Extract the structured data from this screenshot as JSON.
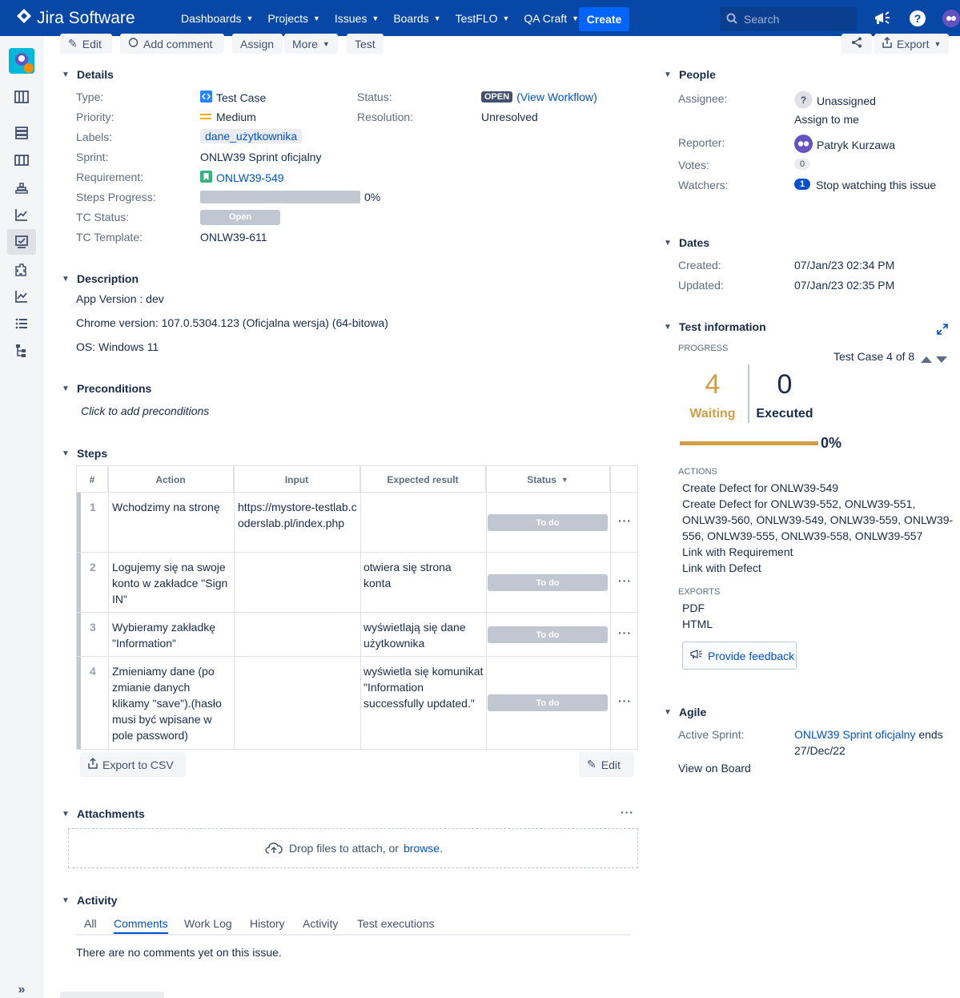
{
  "topnav": {
    "product": "Jira Software",
    "menu": [
      "Dashboards",
      "Projects",
      "Issues",
      "Boards",
      "TestFLO",
      "QA Craft"
    ],
    "create_label": "Create",
    "search_placeholder": "Search",
    "colors": {
      "nav_bg": "#0747a6",
      "create_bg": "#0065ff"
    }
  },
  "sidebar": {
    "items": [
      "project-avatar",
      "board-icon",
      "backlog-icon",
      "board-columns-icon",
      "releases-icon",
      "reports-icon",
      "test-plan-icon",
      "addons-icon",
      "chart-icon",
      "list-icon",
      "tree-icon",
      "expand-icon"
    ]
  },
  "toolbar": {
    "edit": "Edit",
    "add_comment": "Add comment",
    "assign": "Assign",
    "more": "More",
    "test": "Test",
    "export": "Export"
  },
  "details": {
    "title": "Details",
    "type_label": "Type:",
    "type_value": "Test Case",
    "priority_label": "Priority:",
    "priority_value": "Medium",
    "labels_label": "Labels:",
    "labels_value": "dane_użytkownika",
    "sprint_label": "Sprint:",
    "sprint_value": "ONLW39 Sprint oficjalny",
    "requirement_label": "Requirement:",
    "requirement_value": "ONLW39-549",
    "steps_progress_label": "Steps Progress:",
    "steps_progress_value": "0%",
    "steps_progress_fraction": 0,
    "tc_status_label": "TC Status:",
    "tc_status_value": "Open",
    "tc_template_label": "TC Template:",
    "tc_template_value": "ONLW39-611",
    "status_label": "Status:",
    "status_value": "OPEN",
    "view_workflow": "(View Workflow)",
    "resolution_label": "Resolution:",
    "resolution_value": "Unresolved"
  },
  "description": {
    "title": "Description",
    "lines": [
      "App Version : dev",
      "Chrome version: 107.0.5304.123 (Oficjalna wersja) (64-bitowa)",
      "OS: Windows 11"
    ]
  },
  "preconditions": {
    "title": "Preconditions",
    "placeholder": "Click to add preconditions"
  },
  "steps": {
    "title": "Steps",
    "columns": [
      "#",
      "Action",
      "Input",
      "Expected result",
      "Status"
    ],
    "rows": [
      {
        "num": "1",
        "action": "Wchodzimy na stronę",
        "input": "https://mystore-testlab.coderslab.pl/index.php",
        "expected": "",
        "status": "To do"
      },
      {
        "num": "2",
        "action": "Logujemy się na swoje konto w zakładce \"Sign IN\"",
        "input": "",
        "expected": "otwiera się strona konta",
        "status": "To do"
      },
      {
        "num": "3",
        "action": "Wybieramy zakładkę \"Information\"",
        "input": "",
        "expected": "wyświetlają się dane użytkownika",
        "status": "To do"
      },
      {
        "num": "4",
        "action": "Zmieniamy dane (po zmianie danych klikamy \"save\").(hasło musi być wpisane w pole password)",
        "input": "",
        "expected": "wyświetla się komunikat \"Information successfully updated.\"",
        "status": "To do"
      }
    ],
    "export_csv": "Export to CSV",
    "edit": "Edit"
  },
  "attachments": {
    "title": "Attachments",
    "drop_text": "Drop files to attach, or",
    "browse": "browse."
  },
  "activity": {
    "title": "Activity",
    "tabs": [
      "All",
      "Comments",
      "Work Log",
      "History",
      "Activity",
      "Test executions"
    ],
    "active_tab": "Comments",
    "empty": "There are no comments yet on this issue."
  },
  "people": {
    "title": "People",
    "assignee_label": "Assignee:",
    "assignee_value": "Unassigned",
    "assign_to_me": "Assign to me",
    "reporter_label": "Reporter:",
    "reporter_value": "Patryk Kurzawa",
    "votes_label": "Votes:",
    "votes_value": "0",
    "watchers_label": "Watchers:",
    "watchers_count": "1",
    "watchers_action": "Stop watching this issue"
  },
  "dates": {
    "title": "Dates",
    "created_label": "Created:",
    "created_value": "07/Jan/23 02:34 PM",
    "updated_label": "Updated:",
    "updated_value": "07/Jan/23 02:35 PM"
  },
  "test_information": {
    "title": "Test information",
    "progress_label": "PROGRESS",
    "nav_text": "Test Case 4 of 8",
    "waiting_count": "4",
    "waiting_label": "Waiting",
    "executed_count": "0",
    "executed_label": "Executed",
    "progress_value": "0%",
    "actions_label": "ACTIONS",
    "actions": [
      "Create Defect for ONLW39-549",
      "Create Defect for ONLW39-552, ONLW39-551,",
      "ONLW39-560, ONLW39-549, ONLW39-559, ONLW39-",
      "556, ONLW39-555, ONLW39-558, ONLW39-557",
      "Link with Requirement",
      "Link with Defect"
    ],
    "exports_label": "EXPORTS",
    "exports": [
      "PDF",
      "HTML"
    ],
    "feedback": "Provide feedback",
    "colors": {
      "waiting": "#d09e46"
    }
  },
  "agile": {
    "title": "Agile",
    "active_sprint_label": "Active Sprint:",
    "sprint_link": "ONLW39 Sprint oficjalny",
    "sprint_suffix": "ends",
    "sprint_end": "27/Dec/22",
    "view_on_board": "View on Board"
  }
}
